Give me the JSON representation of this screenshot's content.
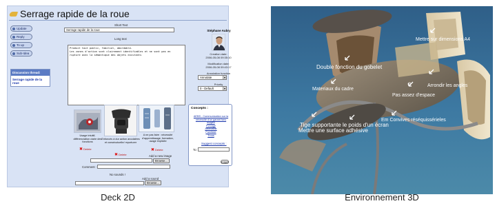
{
  "left_panel": {
    "page_title": "Serrage rapide de la roue",
    "side_buttons": [
      "Update",
      "Reply",
      "To up",
      "Sub-Idea"
    ],
    "nav": {
      "caption": "Discussion thread:",
      "link": "Serrage rapide de la roue"
    },
    "short_text_label": "Short Text",
    "short_text_value": "Serrage rapide de la roue",
    "long_text_label": "Long text",
    "long_text_lines": [
      "Produit tout public, familial, abordable.",
      "Les zones d'action sont clairement identifiables et ne sont pas en",
      "rupture avec la sémantique des objets existants"
    ],
    "author_name": "Stéphane Aubry",
    "creation_label": "Creation date:",
    "creation_date": "2006-05-08 09:35:10",
    "modification_label": "Modification date:",
    "modification_date": "2006-05-08 09:43:17",
    "annotation_label": "Annotation function",
    "annotation_value": "Annotate",
    "priority_label": "Priority",
    "priority_value": "0 - Default",
    "concepts": {
      "caption": "Concepts :",
      "items": [
        "AEBS - Communication sur la nécessité d'un garant fans moyen",
        "Forcage",
        "Abordable",
        "Familiale",
        "Trous"
      ],
      "suggest": "Suggest concepts :",
      "to_label": "To:",
      "insert_label": "Insert"
    },
    "images": [
      {
        "caption": "Usage intuitif, différenciation claire des fonctions",
        "delete": "Delete"
      },
      {
        "caption": "Enfoncés à dur action anodalées et consécutuelle/ repurturer",
        "delete": "Delete"
      },
      {
        "caption": "A ne pas faire : nécessité d'apprentissage, formation, usage implicite",
        "delete": "Delete"
      }
    ],
    "add_image_label": "Add a new image",
    "browse_label": "Browse...",
    "comment_label": "Comment :",
    "no_sounds": "No sounds !",
    "add_sound_label": "Add a sound",
    "browse_label2": "Browse..."
  },
  "right_panel": {
    "labels": [
      "Mettre sur dimensions A4",
      "Double fonction du gobelet",
      "Arrondir les angles",
      "Materiaux du cadre",
      "Pas assez d'espace",
      "Em Convives réséquissérieles",
      "Tige supportante le poids d'un écran",
      "Mettre une surface adhésive"
    ]
  },
  "captions": {
    "left": "Deck 2D",
    "right": "Environnement 3D"
  }
}
